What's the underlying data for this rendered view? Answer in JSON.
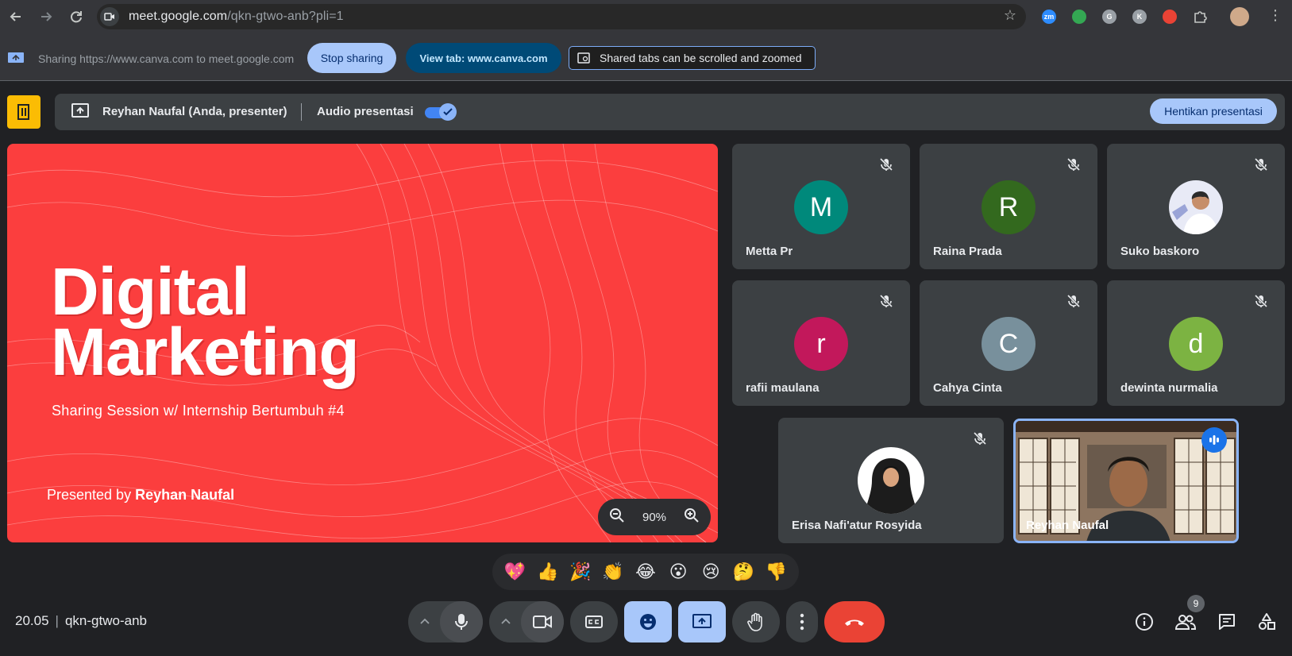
{
  "browser": {
    "url_host": "meet.google.com",
    "url_path": "/qkn-gtwo-anb?pli=1",
    "extensions": [
      {
        "name": "zoom-extension-icon",
        "label": "zm",
        "color": "#2d8cff"
      },
      {
        "name": "sheets-extension-icon",
        "label": "",
        "color": "#34a853"
      },
      {
        "name": "grammarly-extension-icon",
        "label": "G",
        "color": "#9aa0a6"
      },
      {
        "name": "k-extension-icon",
        "label": "K",
        "color": "#9aa0a6"
      },
      {
        "name": "shield-extension-icon",
        "label": "",
        "color": "#ea4335"
      }
    ]
  },
  "share_bar": {
    "text": "Sharing https://www.canva.com to meet.google.com",
    "stop_label": "Stop sharing",
    "view_label": "View tab: www.canva.com",
    "info_label": "Shared tabs can be scrolled and zoomed"
  },
  "presenter_bar": {
    "name": "Reyhan Naufal (Anda, presenter)",
    "audio_label": "Audio presentasi",
    "audio_on": true,
    "stop_label": "Hentikan presentasi"
  },
  "slide": {
    "title_line1": "Digital",
    "title_line2": "Marketing",
    "subtitle": "Sharing Session w/ Internship Bertumbuh #4",
    "presented_by_prefix": "Presented by ",
    "presenter": "Reyhan Naufal",
    "zoom": "90%",
    "bg_color": "#fb3e3e"
  },
  "participants": [
    {
      "name": "Metta Pr",
      "initial": "M",
      "color": "#00897b",
      "muted": true
    },
    {
      "name": "Raina Prada",
      "initial": "R",
      "color": "#33691e",
      "muted": true
    },
    {
      "name": "Suko baskoro",
      "initial": "",
      "color": "#e8eaed",
      "muted": true,
      "photo": true
    },
    {
      "name": "rafii maulana",
      "initial": "r",
      "color": "#c2185b",
      "muted": true
    },
    {
      "name": "Cahya Cinta",
      "initial": "C",
      "color": "#78909c",
      "muted": true
    },
    {
      "name": "dewinta nurmalia",
      "initial": "d",
      "color": "#7cb342",
      "muted": true
    },
    {
      "name": "Erisa Nafi'atur Rosyida",
      "initial": "",
      "color": "#ffffff",
      "muted": true,
      "photo": true
    },
    {
      "name": "Reyhan Naufal",
      "initial": "",
      "color": "#8ab4f8",
      "muted": false,
      "video": true,
      "speaking": true
    }
  ],
  "reactions": [
    "💖",
    "👍",
    "🎉",
    "👏",
    "😂",
    "😮",
    "😢",
    "🤔",
    "👎"
  ],
  "bottom_bar": {
    "time": "20.05",
    "meeting_code": "qkn-gtwo-anb",
    "people_count": "9"
  }
}
